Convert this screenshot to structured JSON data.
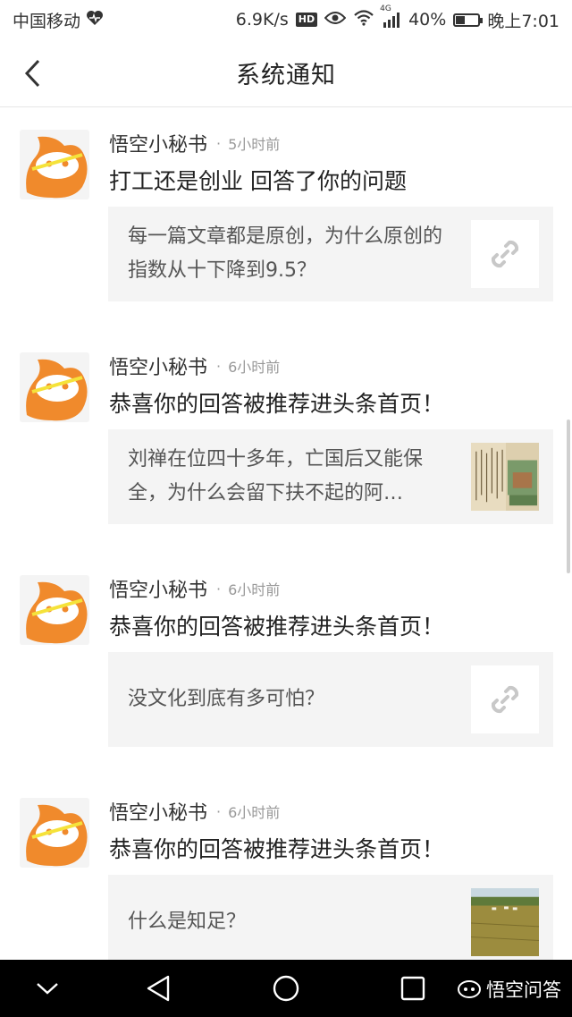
{
  "status_bar": {
    "carrier": "中国移动",
    "speed": "6.9K/s",
    "hd": "HD",
    "network": "4G",
    "battery": "40%",
    "battery_level": 0.4,
    "time": "晚上7:01"
  },
  "header": {
    "title": "系统通知"
  },
  "notifications": [
    {
      "sender": "悟空小秘书",
      "dot": "·",
      "time": "5小时前",
      "message": "打工还是创业 回答了你的问题",
      "card_text": "每一篇文章都是原创，为什么原创的指数从十下降到9.5？",
      "thumb": "link-icon"
    },
    {
      "sender": "悟空小秘书",
      "dot": "·",
      "time": "6小时前",
      "message": "恭喜你的回答被推荐进头条首页！",
      "card_text": "刘禅在位四十多年，亡国后又能保全，为什么会留下扶不起的阿…",
      "thumb": "painting-image"
    },
    {
      "sender": "悟空小秘书",
      "dot": "·",
      "time": "6小时前",
      "message": "恭喜你的回答被推荐进头条首页！",
      "card_text": "没文化到底有多可怕？",
      "thumb": "link-icon"
    },
    {
      "sender": "悟空小秘书",
      "dot": "·",
      "time": "6小时前",
      "message": "恭喜你的回答被推荐进头条首页！",
      "card_text": "什么是知足？",
      "thumb": "field-image"
    }
  ],
  "nav_bar": {
    "watermark": "悟空问答"
  },
  "colors": {
    "accent_orange": "#F08A2C",
    "card_bg": "#F4F4F4",
    "muted_text": "#999999"
  }
}
